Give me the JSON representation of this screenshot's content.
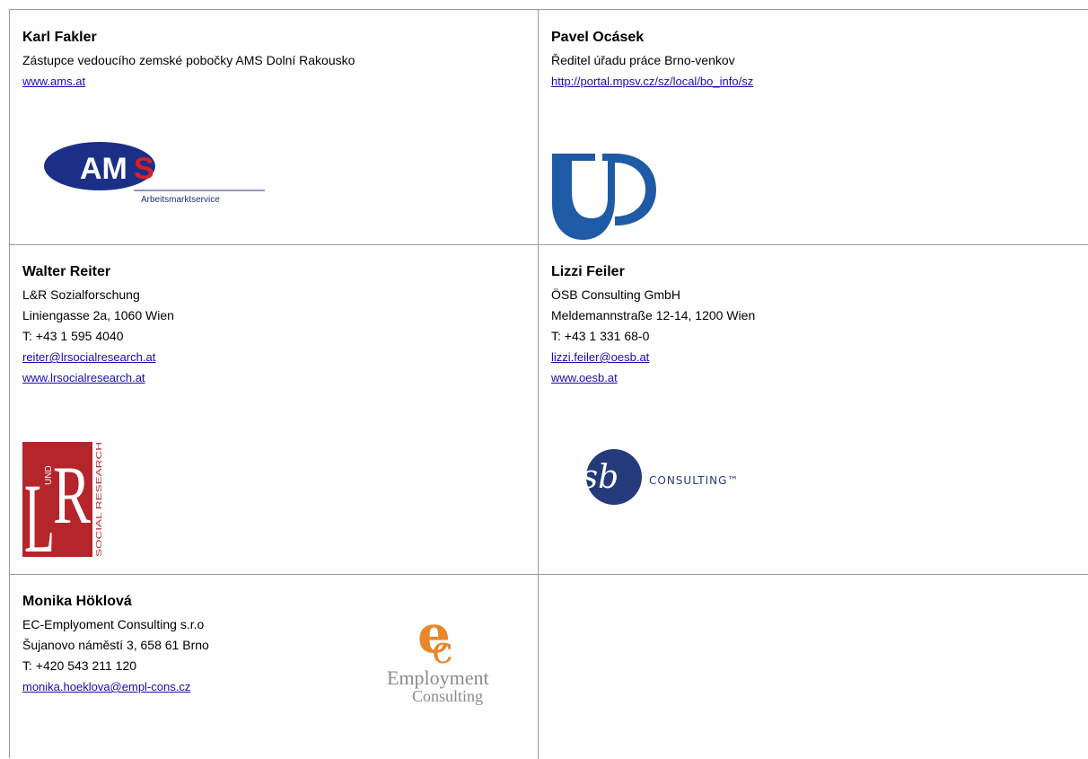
{
  "contacts": [
    {
      "name": "Karl Fakler",
      "lines": [
        "Zástupce vedoucího zemské pobočky AMS Dolní Rakousko"
      ],
      "links": [
        "www.ams.at"
      ],
      "logo": {
        "icon": "ams-logo",
        "text": "AMS",
        "subtext": "Arbeitsmarktservice"
      }
    },
    {
      "name": "Pavel Ocásek",
      "lines": [
        "Ředitel úřadu práce Brno-venkov"
      ],
      "links": [
        "http://portal.mpsv.cz/sz/local/bo_info/sz"
      ],
      "logo": {
        "icon": "up-logo"
      }
    },
    {
      "name": "Walter Reiter",
      "lines": [
        "L&R Sozialforschung",
        "Liniengasse 2a, 1060 Wien",
        "T: +43 1 595 4040"
      ],
      "links": [
        "reiter@lrsocialresearch.at",
        "www.lrsocialresearch.at"
      ],
      "logo": {
        "icon": "lr-logo",
        "text_left": "L",
        "text_right": "R",
        "text_und": "UND",
        "text_side": "SOCIAL RESEARCH"
      }
    },
    {
      "name": "Lizzi Feiler",
      "lines": [
        "ÖSB Consulting GmbH",
        "Meldemannstraße 12-14, 1200 Wien",
        "T: +43 1 331 68-0"
      ],
      "links": [
        "lizzi.feiler@oesb.at",
        "www.oesb.at"
      ],
      "logo": {
        "icon": "osb-logo",
        "text": "ösb",
        "subtext": "CONSULTING™"
      }
    },
    {
      "name": "Monika Höklová",
      "lines": [
        "EC-Emplyoment Consulting s.r.o",
        "Šujanovo náměstí 3, 658 61 Brno",
        "T: +420 543 211 120"
      ],
      "links": [
        "monika.hoeklova@empl-cons.cz"
      ],
      "logo": {
        "icon": "ec-logo",
        "text": "Employment",
        "subtext": "Consulting"
      }
    }
  ],
  "colors": {
    "ams_blue": "#1c2f86",
    "ams_red": "#d4202b",
    "up_blue": "#1f5aa6",
    "lr_red": "#b5252c",
    "osb_navy": "#243a7a",
    "ec_orange": "#e8872a",
    "ec_gray": "#8a8a8a",
    "link": "#1a0dab"
  }
}
